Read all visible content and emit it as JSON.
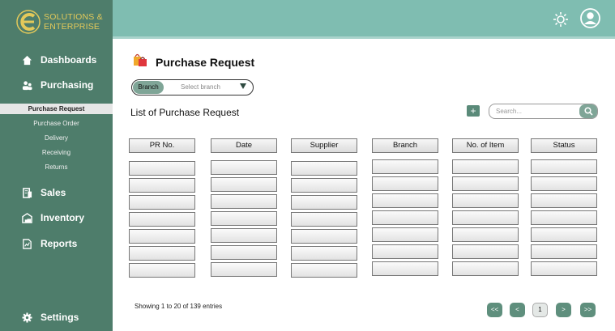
{
  "brand": {
    "line1": "SOLUTIONS &",
    "line2": "ENTERPRISE",
    "logo_icon": "e-logo-icon",
    "color": "#e3c95a"
  },
  "sidebar": {
    "items": [
      {
        "label": "Dashboards",
        "icon": "home-icon"
      },
      {
        "label": "Purchasing",
        "icon": "users-icon"
      },
      {
        "label": "Sales",
        "icon": "receipt-icon"
      },
      {
        "label": "Inventory",
        "icon": "warehouse-icon"
      },
      {
        "label": "Reports",
        "icon": "report-icon"
      }
    ],
    "subitems": [
      {
        "label": "Purchase Request",
        "active": true
      },
      {
        "label": "Purchase Order",
        "active": false
      },
      {
        "label": "Delivery",
        "active": false
      },
      {
        "label": "Receiving",
        "active": false
      },
      {
        "label": "Returns",
        "active": false
      }
    ],
    "settings": {
      "label": "Settings",
      "icon": "gear-icon"
    }
  },
  "topbar": {
    "theme_icon": "sun-icon",
    "profile_icon": "user-avatar-icon"
  },
  "page": {
    "title": "Purchase Request",
    "title_icon": "shopping-bags-icon"
  },
  "branch": {
    "tag": "Branch",
    "placeholder": "Select branch"
  },
  "list": {
    "title": "List of Purchase Request",
    "add_label": "+",
    "search_placeholder": "Search..."
  },
  "table": {
    "columns": [
      "PR No.",
      "Date",
      "Supplier",
      "Branch",
      "No. of Item",
      "Status"
    ],
    "row_count": 7
  },
  "footer": {
    "showing": "Showing 1 to 20 of 139 entries"
  },
  "pagination": {
    "first": "<<",
    "prev": "<",
    "current": "1",
    "next": ">",
    "last": ">>"
  },
  "colors": {
    "sidebar": "#4e7d6b",
    "topbar": "#7fbdb1",
    "accent": "#5f8f7d"
  }
}
